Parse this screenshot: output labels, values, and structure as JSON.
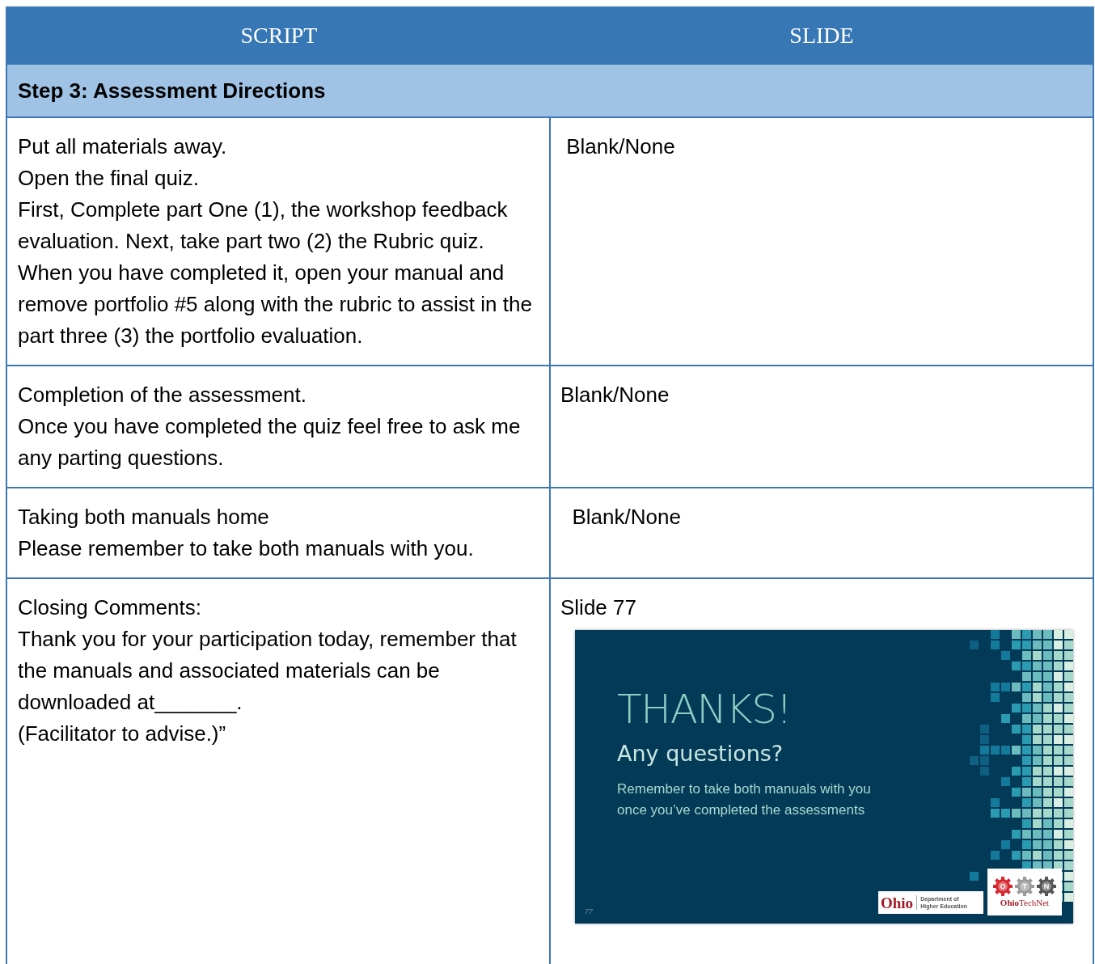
{
  "table": {
    "columns": [
      "SCRIPT",
      "SLIDE"
    ],
    "section": "Step 3: Assessment Directions",
    "rows": [
      {
        "script": [
          "Put all materials away.",
          "Open the final quiz.",
          "First, Complete part One (1), the workshop feedback evaluation. Next, take part two (2) the Rubric quiz. When you have completed it, open your manual and remove portfolio #5 along with the rubric to assist in the part three (3) the portfolio evaluation."
        ],
        "slide": " Blank/None"
      },
      {
        "script": [
          "Completion of the assessment.",
          "Once you have completed the quiz feel free to ask me any parting questions."
        ],
        "slide": "Blank/None"
      },
      {
        "script": [
          "Taking both manuals home",
          "Please remember to take both manuals with you."
        ],
        "slide": "  Blank/None"
      },
      {
        "script": [
          "Closing Comments:",
          "Thank you for your participation today, remember that the manuals and associated materials can be downloaded at_______.",
          "(Facilitator to advise.)”"
        ],
        "slide": "Slide 77",
        "thumbnail": {
          "title": "THANKS!",
          "subtitle": "Any questions?",
          "body": "Remember to take both manuals with you once you’ve completed the assessments",
          "page_number": "77",
          "ohio_logo": {
            "word": "Ohio",
            "dept": [
              "Department of",
              "Higher Education"
            ]
          },
          "technet_logo": {
            "gears": [
              "O",
              "T",
              "N"
            ],
            "name_bold": "Ohio",
            "name_rest": "TechNet"
          }
        }
      }
    ]
  }
}
